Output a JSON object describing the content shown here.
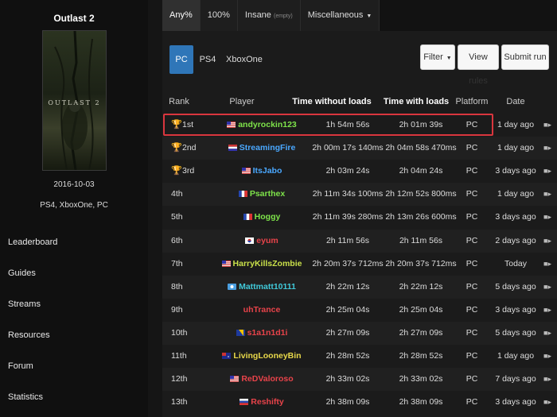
{
  "game": {
    "title": "Outlast 2",
    "cover_logo": "OUTLAST 2",
    "release_date": "2016-10-03",
    "platforms": "PS4, XboxOne, PC"
  },
  "nav": [
    {
      "label": "Leaderboard"
    },
    {
      "label": "Guides"
    },
    {
      "label": "Streams"
    },
    {
      "label": "Resources"
    },
    {
      "label": "Forum"
    },
    {
      "label": "Statistics"
    }
  ],
  "tabs": {
    "any": "Any%",
    "hundred": "100%",
    "insane": "Insane",
    "insane_note": "(empty)",
    "misc": "Miscellaneous"
  },
  "platform_filters": {
    "pc": "PC",
    "ps4": "PS4",
    "xbox": "XboxOne"
  },
  "actions": {
    "filter": "Filter",
    "view_rules": "View rules",
    "submit_run": "Submit run"
  },
  "columns": {
    "rank": "Rank",
    "player": "Player",
    "time_without_loads": "Time without loads",
    "time_with_loads": "Time with loads",
    "platform": "Platform",
    "date": "Date"
  },
  "runs": [
    {
      "rank": "1st",
      "trophy": "gold",
      "player": "andyrockin123",
      "player_color": "#7ee34a",
      "flag": "us",
      "time_without_loads": "1h 54m 56s",
      "time_with_loads": "2h 01m 39s",
      "platform": "PC",
      "date": "1 day ago"
    },
    {
      "rank": "2nd",
      "trophy": "silver",
      "player": "StreamingFire",
      "player_color": "#4aa8ff",
      "flag": "nl",
      "time_without_loads": "2h 00m 17s 140ms",
      "time_with_loads": "2h 04m 58s 470ms",
      "platform": "PC",
      "date": "1 day ago"
    },
    {
      "rank": "3rd",
      "trophy": "bronze",
      "player": "ItsJabo",
      "player_color": "#4aa8ff",
      "flag": "us",
      "time_without_loads": "2h 03m 24s",
      "time_with_loads": "2h 04m 24s",
      "platform": "PC",
      "date": "3 days ago"
    },
    {
      "rank": "4th",
      "trophy": "",
      "player": "Psarthex",
      "player_color": "#7ee34a",
      "flag": "fr",
      "time_without_loads": "2h 11m 34s 100ms",
      "time_with_loads": "2h 12m 52s 800ms",
      "platform": "PC",
      "date": "1 day ago"
    },
    {
      "rank": "5th",
      "trophy": "",
      "player": "Hoggy",
      "player_color": "#7ee34a",
      "flag": "fr",
      "time_without_loads": "2h 11m 39s 280ms",
      "time_with_loads": "2h 13m 26s 600ms",
      "platform": "PC",
      "date": "3 days ago"
    },
    {
      "rank": "6th",
      "trophy": "",
      "player": "eyum",
      "player_color": "#e8434a",
      "flag": "kr",
      "time_without_loads": "2h 11m 56s",
      "time_with_loads": "2h 11m 56s",
      "platform": "PC",
      "date": "2 days ago"
    },
    {
      "rank": "7th",
      "trophy": "",
      "player": "HarryKillsZombie",
      "player_color": "#c9e04a",
      "flag": "us",
      "time_without_loads": "2h 20m 37s 712ms",
      "time_with_loads": "2h 20m 37s 712ms",
      "platform": "PC",
      "date": "Today"
    },
    {
      "rank": "8th",
      "trophy": "",
      "player": "Mattmatt10111",
      "player_color": "#40c8d8",
      "flag": "un",
      "time_without_loads": "2h 22m 12s",
      "time_with_loads": "2h 22m 12s",
      "platform": "PC",
      "date": "5 days ago"
    },
    {
      "rank": "9th",
      "trophy": "",
      "player": "uhTrance",
      "player_color": "#e8434a",
      "flag": "",
      "time_without_loads": "2h 25m 04s",
      "time_with_loads": "2h 25m 04s",
      "platform": "PC",
      "date": "3 days ago"
    },
    {
      "rank": "10th",
      "trophy": "",
      "player": "s1a1n1d1i",
      "player_color": "#e8434a",
      "flag": "ba",
      "time_without_loads": "2h 27m 09s",
      "time_with_loads": "2h 27m 09s",
      "platform": "PC",
      "date": "5 days ago"
    },
    {
      "rank": "11th",
      "trophy": "",
      "player": "LivingLooneyBin",
      "player_color": "#e8d84a",
      "flag": "au",
      "time_without_loads": "2h 28m 52s",
      "time_with_loads": "2h 28m 52s",
      "platform": "PC",
      "date": "1 day ago"
    },
    {
      "rank": "12th",
      "trophy": "",
      "player": "ReDValoroso",
      "player_color": "#e8434a",
      "flag": "us",
      "time_without_loads": "2h 33m 02s",
      "time_with_loads": "2h 33m 02s",
      "platform": "PC",
      "date": "7 days ago"
    },
    {
      "rank": "13th",
      "trophy": "",
      "player": "Reshifty",
      "player_color": "#e8434a",
      "flag": "ru",
      "time_without_loads": "2h 38m 09s",
      "time_with_loads": "2h 38m 09s",
      "platform": "PC",
      "date": "3 days ago"
    }
  ],
  "colors": {
    "gold": "#e6b32e",
    "silver": "#bfbfbf",
    "bronze": "#c97a3a",
    "accent": "#2f76b8",
    "highlight": "#d9363e"
  },
  "icons": {
    "trophy": "trophy-icon",
    "video": "video-camera-icon",
    "caret": "caret-down-icon"
  }
}
